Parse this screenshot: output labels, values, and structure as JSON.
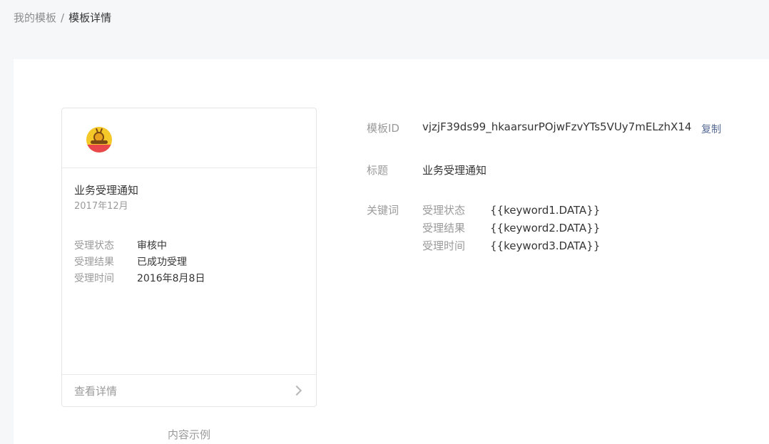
{
  "breadcrumb": {
    "parent": "我的模板",
    "separator": "/",
    "current": "模板详情"
  },
  "preview": {
    "title": "业务受理通知",
    "date": "2017年12月",
    "rows": [
      {
        "key": "受理状态",
        "value": "审核中"
      },
      {
        "key": "受理结果",
        "value": "已成功受理"
      },
      {
        "key": "受理时间",
        "value": "2016年8月8日"
      }
    ],
    "footer_label": "查看详情",
    "caption": "内容示例"
  },
  "detail": {
    "id_label": "模板ID",
    "id_value": "vjzjF39ds99_hkaarsurPOjwFzvYTs5VUy7mELzhX14",
    "copy_label": "复制",
    "title_label": "标题",
    "title_value": "业务受理通知",
    "keywords_label": "关键词",
    "keywords": [
      {
        "name": "受理状态",
        "value": "{{keyword1.DATA}}"
      },
      {
        "name": "受理结果",
        "value": "{{keyword2.DATA}}"
      },
      {
        "name": "受理时间",
        "value": "{{keyword3.DATA}}"
      }
    ]
  },
  "colors": {
    "page_bg": "#f6f7f9",
    "panel_bg": "#ffffff",
    "link": "#576b95",
    "muted": "#9a9a9a",
    "text": "#353535"
  }
}
